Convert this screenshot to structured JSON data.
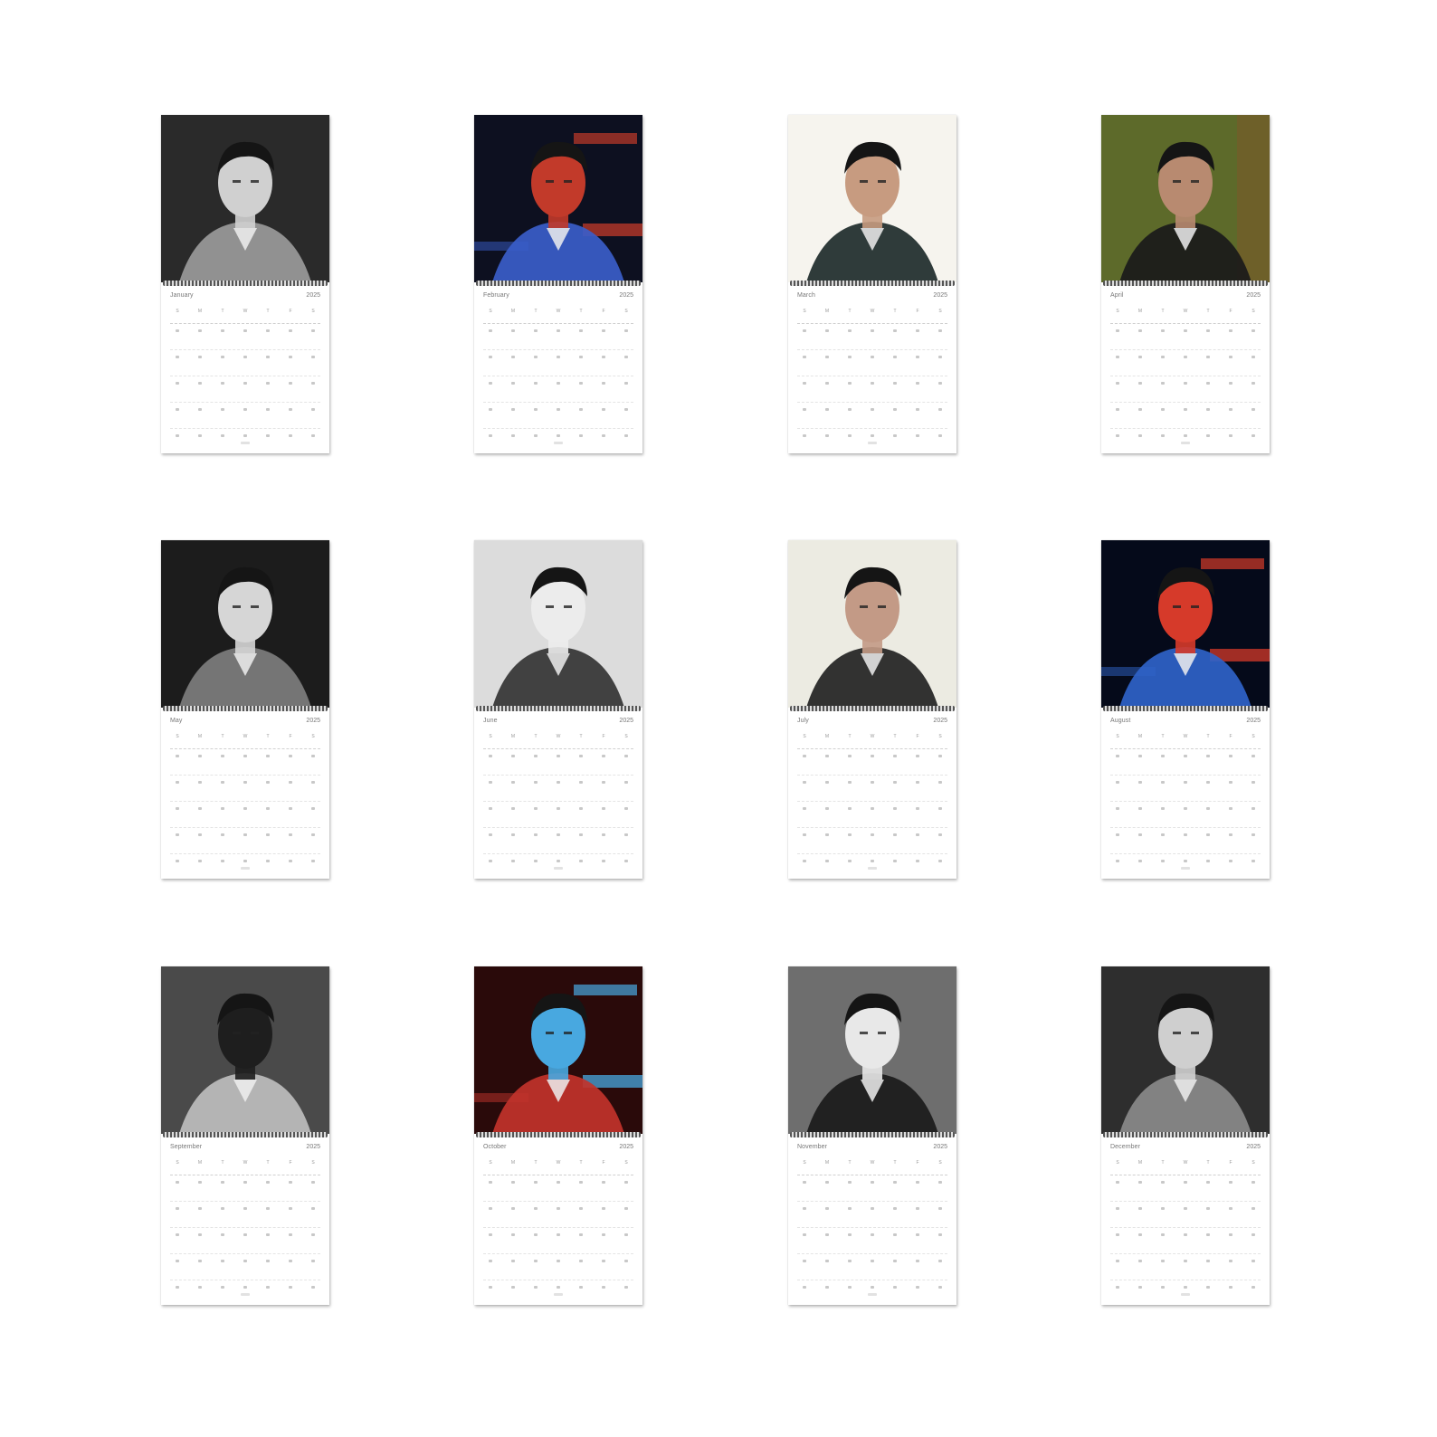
{
  "calendar": {
    "year_label": "2025",
    "weekdays": [
      "S",
      "M",
      "T",
      "W",
      "T",
      "F",
      "S"
    ],
    "months": [
      {
        "name": "January"
      },
      {
        "name": "February"
      },
      {
        "name": "March"
      },
      {
        "name": "April"
      },
      {
        "name": "May"
      },
      {
        "name": "June"
      },
      {
        "name": "July"
      },
      {
        "name": "August"
      },
      {
        "name": "September"
      },
      {
        "name": "October"
      },
      {
        "name": "November"
      },
      {
        "name": "December"
      }
    ]
  },
  "photos": [
    {
      "style": "bw-closeup",
      "palette": [
        "#2a2a2a",
        "#9a9a9a",
        "#d0d0d0"
      ]
    },
    {
      "style": "neon-dark",
      "palette": [
        "#0d1020",
        "#3a5dc9",
        "#c23a2a"
      ]
    },
    {
      "style": "light-bg",
      "palette": [
        "#f6f4ee",
        "#1d2a2a",
        "#c79b80"
      ]
    },
    {
      "style": "green-bg",
      "palette": [
        "#5d6a2a",
        "#1a1a1a",
        "#b88a70"
      ]
    },
    {
      "style": "bw-seated",
      "palette": [
        "#1c1c1c",
        "#7d7d7d",
        "#d6d6d6"
      ]
    },
    {
      "style": "bw-light",
      "palette": [
        "#dcdcdc",
        "#333333",
        "#ececec"
      ]
    },
    {
      "style": "light-jacket",
      "palette": [
        "#ecebe2",
        "#222222",
        "#c39a86"
      ]
    },
    {
      "style": "neon-blue",
      "palette": [
        "#050a1a",
        "#2f63c8",
        "#d63a2a"
      ]
    },
    {
      "style": "bw-outdoor",
      "palette": [
        "#4a4a4a",
        "#bdbdbd",
        "#1e1e1e"
      ]
    },
    {
      "style": "neon-red",
      "palette": [
        "#2a0a0a",
        "#c1332b",
        "#48a8e0"
      ]
    },
    {
      "style": "bw-studio",
      "palette": [
        "#6e6e6e",
        "#1a1a1a",
        "#e8e8e8"
      ]
    },
    {
      "style": "bw-double",
      "palette": [
        "#2e2e2e",
        "#8a8a8a",
        "#cfcfcf"
      ]
    }
  ]
}
